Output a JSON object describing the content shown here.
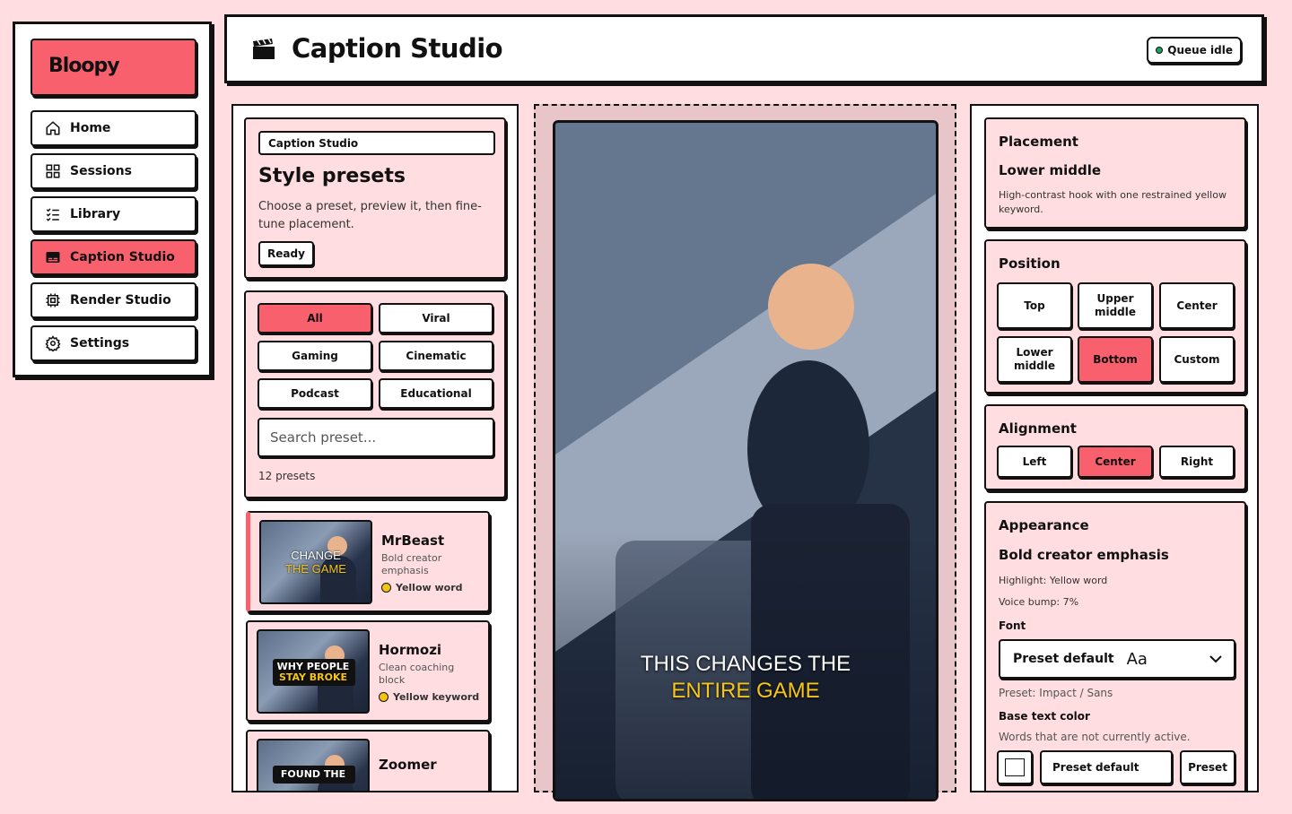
{
  "brand": "Bloopy",
  "sidebar": {
    "items": [
      {
        "label": "Home",
        "icon": "home-icon"
      },
      {
        "label": "Sessions",
        "icon": "grid-icon"
      },
      {
        "label": "Library",
        "icon": "list-icon"
      },
      {
        "label": "Caption Studio",
        "icon": "caption-icon",
        "active": true
      },
      {
        "label": "Render Studio",
        "icon": "chip-icon"
      },
      {
        "label": "Settings",
        "icon": "gear-icon"
      }
    ]
  },
  "header": {
    "title": "Caption Studio",
    "status": "Queue idle",
    "status_color": "#1ea35a"
  },
  "style_card": {
    "breadcrumb": "Caption Studio",
    "title": "Style presets",
    "description": "Choose a preset, preview it, then fine-tune placement.",
    "status": "Ready"
  },
  "filters": {
    "chips": [
      "All",
      "Viral",
      "Gaming",
      "Cinematic",
      "Podcast",
      "Educational"
    ],
    "active": "All",
    "search_placeholder": "Search preset...",
    "count": "12 presets"
  },
  "presets": [
    {
      "name": "MrBeast",
      "desc": "Bold creator emphasis",
      "tag": "Yellow word",
      "thumb_line1": "CHANGE",
      "thumb_line2": "THE GAME"
    },
    {
      "name": "Hormozi",
      "desc": "Clean coaching block",
      "tag": "Yellow keyword",
      "thumb_line1": "WHY PEOPLE",
      "thumb_line2": "STAY BROKE"
    },
    {
      "name": "Zoomer",
      "desc": "",
      "tag": "",
      "thumb_line1": "FOUND THE",
      "thumb_line2": ""
    }
  ],
  "preview": {
    "caption_line1": "THIS CHANGES THE",
    "caption_line2": "ENTIRE GAME",
    "highlight_color": "#f5c518"
  },
  "placement": {
    "heading": "Placement",
    "value": "Lower middle",
    "description": "High-contrast hook with one restrained yellow keyword."
  },
  "position": {
    "heading": "Position",
    "options": [
      "Top",
      "Upper middle",
      "Center",
      "Lower middle",
      "Bottom",
      "Custom"
    ],
    "active": "Bottom"
  },
  "alignment": {
    "heading": "Alignment",
    "options": [
      "Left",
      "Center",
      "Right"
    ],
    "active": "Center"
  },
  "appearance": {
    "heading": "Appearance",
    "value": "Bold creator emphasis",
    "highlight": "Highlight: Yellow word",
    "voice_bump": "Voice bump: 7%",
    "font_label": "Font",
    "font_value": "Preset default",
    "font_sample": "Aa",
    "font_preset": "Preset: Impact / Sans",
    "base_color_label": "Base text color",
    "base_color_desc": "Words that are not currently active.",
    "color_value": "Preset default",
    "color_button": "Preset"
  },
  "accent_color": "#f9606e"
}
